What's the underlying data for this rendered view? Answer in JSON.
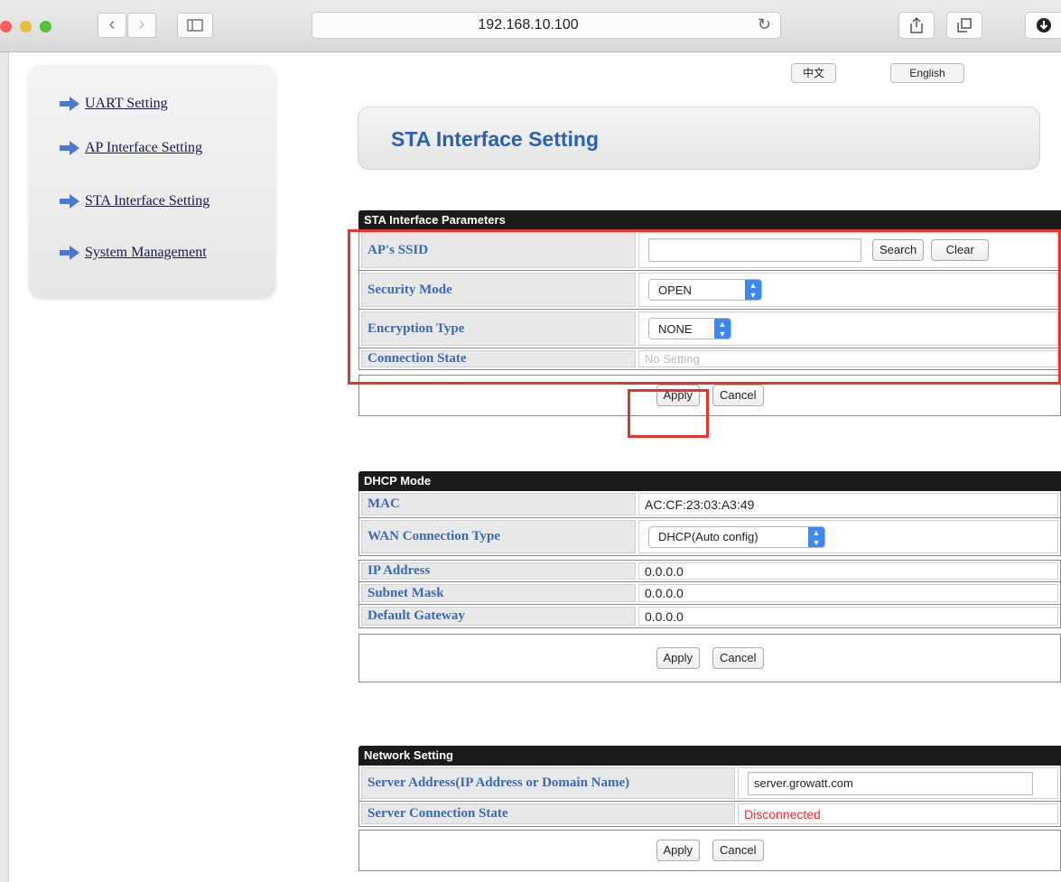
{
  "browser": {
    "url": "192.168.10.100"
  },
  "language": {
    "chinese": "中文",
    "english": "English"
  },
  "sidebar": {
    "items": [
      {
        "label": "UART Setting"
      },
      {
        "label": "AP Interface Setting"
      },
      {
        "label": "STA Interface Setting"
      },
      {
        "label": "System Management"
      }
    ]
  },
  "page_title": "STA Interface Setting",
  "sta": {
    "header": "STA Interface Parameters",
    "ssid_label": "AP's SSID",
    "ssid_value": "",
    "search_label": "Search",
    "clear_label": "Clear",
    "security_label": "Security Mode",
    "security_value": "OPEN",
    "encryption_label": "Encryption Type",
    "encryption_value": "NONE",
    "connection_label": "Connection State",
    "connection_value": "No Setting",
    "apply_label": "Apply",
    "cancel_label": "Cancel"
  },
  "dhcp": {
    "header": "DHCP Mode",
    "mac_label": "MAC",
    "mac_value": "AC:CF:23:03:A3:49",
    "wan_label": "WAN Connection Type",
    "wan_value": "DHCP(Auto config)",
    "ip_label": "IP Address",
    "ip_value": "0.0.0.0",
    "subnet_label": "Subnet Mask",
    "subnet_value": "0.0.0.0",
    "gateway_label": "Default Gateway",
    "gateway_value": "0.0.0.0",
    "apply_label": "Apply",
    "cancel_label": "Cancel"
  },
  "network": {
    "header": "Network Setting",
    "server_label": "Server Address(IP Address or Domain Name)",
    "server_value": "server.growatt.com",
    "state_label": "Server Connection State",
    "state_value": "Disconnected",
    "state_color": "#ff2a2a",
    "apply_label": "Apply",
    "cancel_label": "Cancel"
  },
  "colors": {
    "accent": "#2b61b5",
    "highlight": "#e6352d"
  }
}
